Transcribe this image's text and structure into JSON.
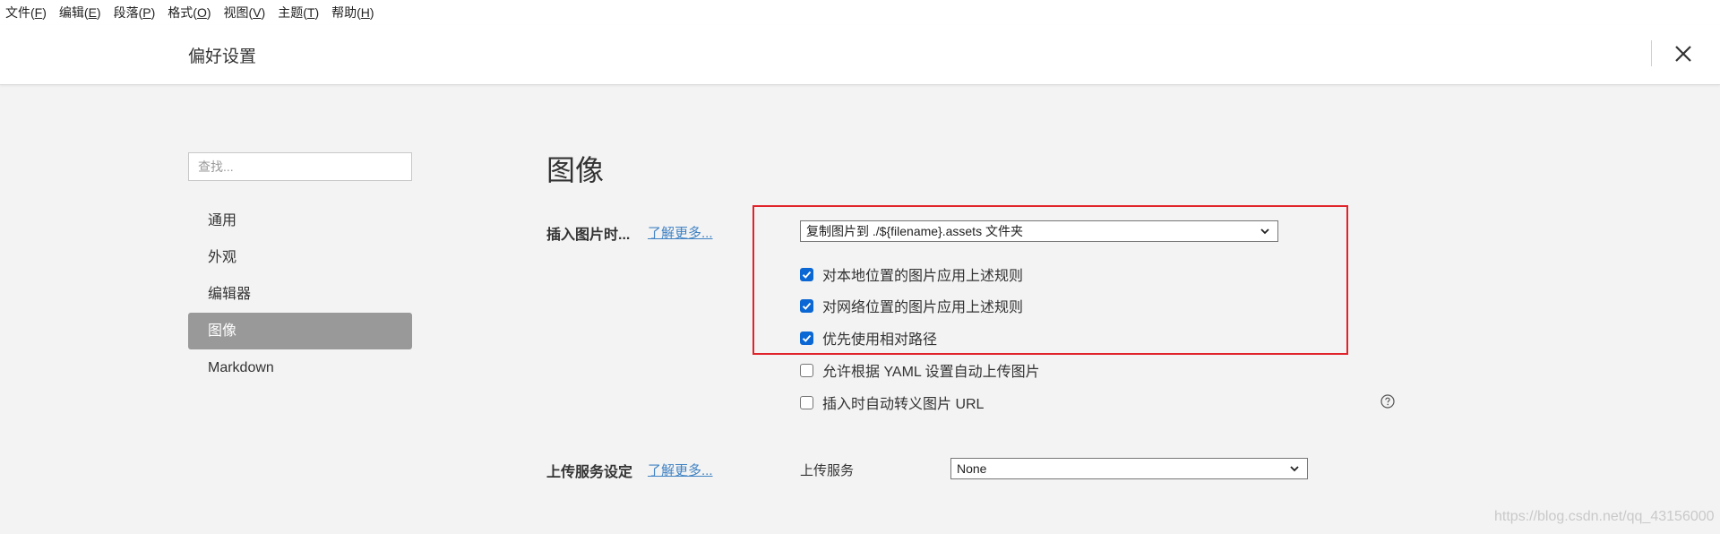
{
  "menubar": {
    "items": [
      {
        "label": "文件(",
        "acc": "F",
        "tail": ")"
      },
      {
        "label": "编辑(",
        "acc": "E",
        "tail": ")"
      },
      {
        "label": "段落(",
        "acc": "P",
        "tail": ")"
      },
      {
        "label": "格式(",
        "acc": "O",
        "tail": ")"
      },
      {
        "label": "视图(",
        "acc": "V",
        "tail": ")"
      },
      {
        "label": "主题(",
        "acc": "T",
        "tail": ")"
      },
      {
        "label": "帮助(",
        "acc": "H",
        "tail": ")"
      }
    ]
  },
  "header": {
    "title": "偏好设置",
    "close_icon": "close-icon"
  },
  "sidebar": {
    "search_placeholder": "查找...",
    "items": [
      {
        "label": "通用",
        "active": false
      },
      {
        "label": "外观",
        "active": false
      },
      {
        "label": "编辑器",
        "active": false
      },
      {
        "label": "图像",
        "active": true
      },
      {
        "label": "Markdown",
        "active": false
      }
    ]
  },
  "content": {
    "section_title": "图像",
    "insert": {
      "label": "插入图片时...",
      "learn_more": "了解更多...",
      "select_value": "复制图片到 ./${filename}.assets 文件夹",
      "checkboxes": [
        {
          "label": "对本地位置的图片应用上述规则",
          "checked": true
        },
        {
          "label": "对网络位置的图片应用上述规则",
          "checked": true
        },
        {
          "label": "优先使用相对路径",
          "checked": true
        },
        {
          "label": "允许根据 YAML 设置自动上传图片",
          "checked": false
        },
        {
          "label": "插入时自动转义图片 URL",
          "checked": false
        }
      ]
    },
    "upload": {
      "label": "上传服务设定",
      "learn_more": "了解更多...",
      "service_label": "上传服务",
      "service_value": "None"
    }
  },
  "colors": {
    "highlight": "#e0232b",
    "checkbox_on": "#0b67d3",
    "link": "#4183c4",
    "active_item": "#999999"
  },
  "watermark": "https://blog.csdn.net/qq_43156000"
}
